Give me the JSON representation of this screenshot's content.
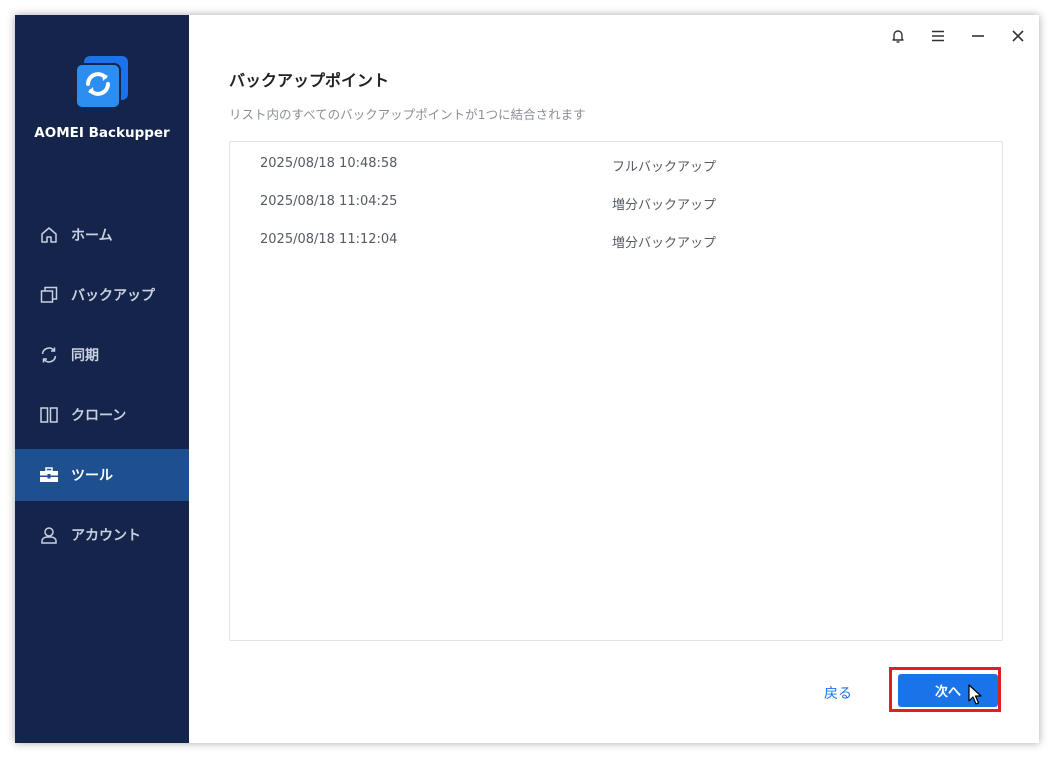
{
  "app": {
    "name": "AOMEI Backupper"
  },
  "sidebar": {
    "items": [
      {
        "label": "ホーム",
        "icon": "home-icon"
      },
      {
        "label": "バックアップ",
        "icon": "backup-icon"
      },
      {
        "label": "同期",
        "icon": "sync-icon"
      },
      {
        "label": "クローン",
        "icon": "clone-icon"
      },
      {
        "label": "ツール",
        "icon": "toolbox-icon",
        "active": true
      },
      {
        "label": "アカウント",
        "icon": "user-icon"
      }
    ]
  },
  "titlebar": {
    "buttons": [
      "bell-icon",
      "menu-icon",
      "minimize-icon",
      "close-icon"
    ]
  },
  "main": {
    "title": "バックアップポイント",
    "subtitle": "リスト内のすべてのバックアップポイントが1つに結合されます",
    "rows": [
      {
        "date": "2025/08/18 10:48:58",
        "type": "フルバックアップ"
      },
      {
        "date": "2025/08/18 11:04:25",
        "type": "増分バックアップ"
      },
      {
        "date": "2025/08/18 11:12:04",
        "type": "増分バックアップ"
      }
    ]
  },
  "footer": {
    "back_label": "戻る",
    "next_label": "次へ"
  },
  "colors": {
    "sidebar_bg": "#14244a",
    "sidebar_active": "#1e4f8f",
    "accent": "#1a73e8",
    "highlight": "#e02020"
  }
}
